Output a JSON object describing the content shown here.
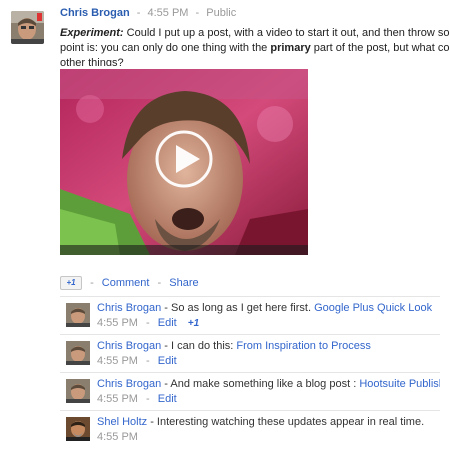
{
  "post": {
    "author": "Chris Brogan",
    "time": "4:55 PM",
    "visibility": "Public",
    "header_sep": "-",
    "body_label": "Experiment:",
    "body_part1": " Could I put up a post, with a video to start it out, and then throw some",
    "body_part2": "point is: you can only do one thing with the ",
    "body_bold": "primary",
    "body_part3": " part of the post, but what could",
    "body_part4": "other things?"
  },
  "actions": {
    "plusone_label": "+1",
    "comment_label": "Comment",
    "share_label": "Share",
    "sep": "-"
  },
  "comments": [
    {
      "author": "Chris Brogan",
      "text": " - So as long as I get here first. ",
      "link": "Google Plus Quick Look",
      "time": "4:55 PM",
      "edit": "Edit",
      "plus": "+1"
    },
    {
      "author": "Chris Brogan",
      "text": " - I can do this: ",
      "link": "From Inspiration to Process",
      "time": "4:55 PM",
      "edit": "Edit"
    },
    {
      "author": "Chris Brogan",
      "text": " - And make something like a blog post : ",
      "link": "Hootsuite Publisher F",
      "time": "4:55 PM",
      "edit": "Edit"
    },
    {
      "author": "Shel Holtz",
      "text": " - Interesting watching these updates appear in real time.",
      "time": "4:55 PM"
    }
  ],
  "colors": {
    "link": "#3366cc",
    "author": "#2a5db0",
    "muted": "#999999"
  },
  "icons": {
    "video_play": "play-icon"
  }
}
